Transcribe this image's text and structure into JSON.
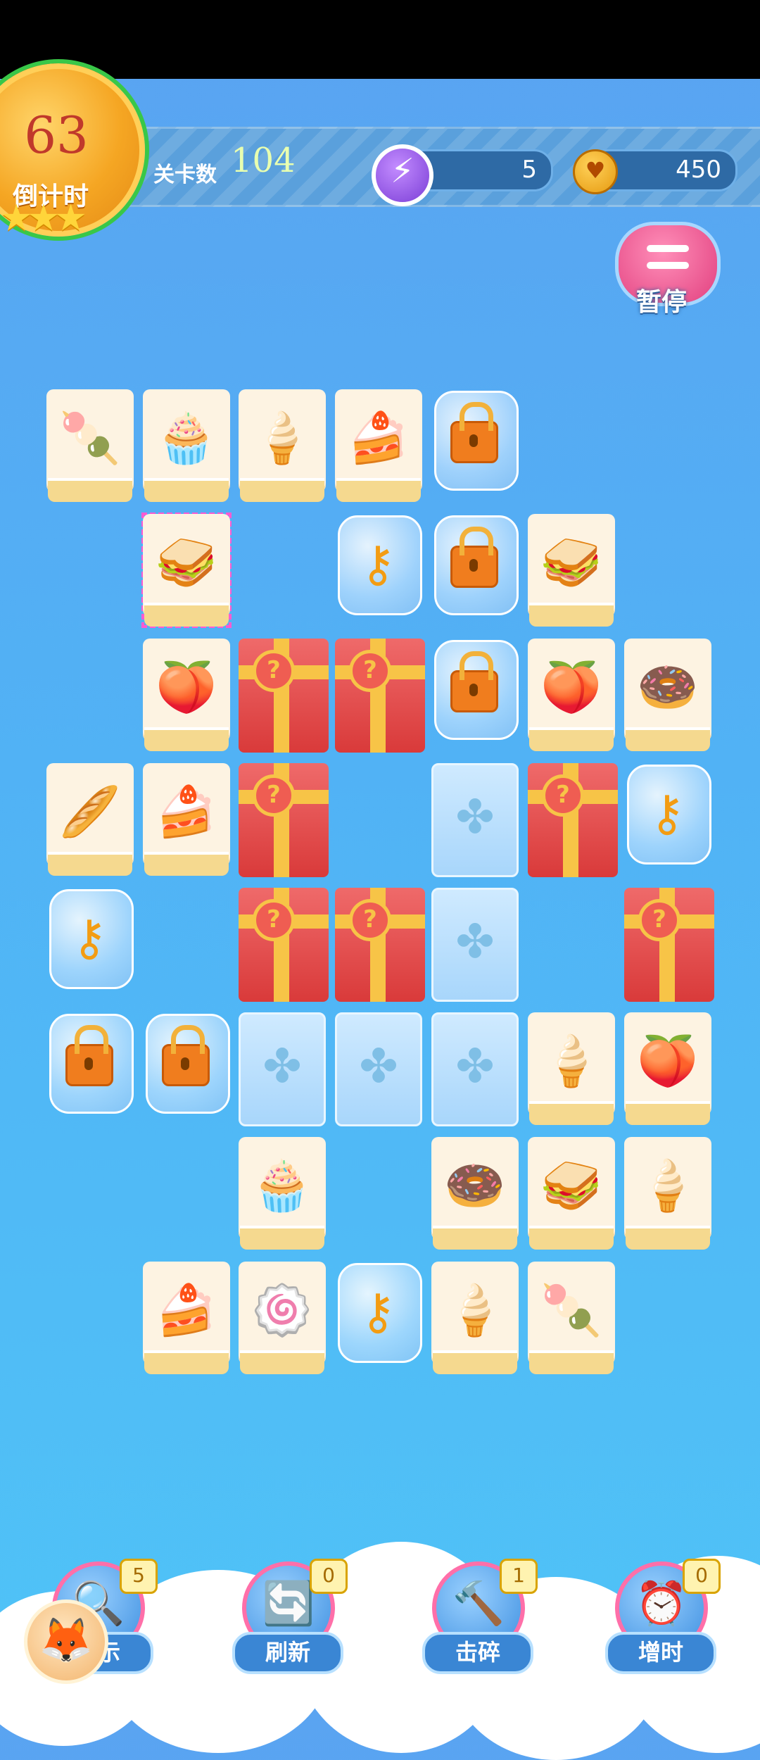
{
  "hud": {
    "timer_value": "63",
    "timer_label": "倒计时",
    "level_label": "关卡数",
    "level_value": "104",
    "energy_value": "5",
    "coins_value": "450",
    "pause_label": "暂停"
  },
  "icons": {
    "energy": "lightning-icon",
    "coins": "heart-coin-icon",
    "pause": "menu-icon"
  },
  "colors": {
    "accent_pink": "#e2407f",
    "tile_cream": "#fdf3e2",
    "gift_red": "#d93a3a",
    "ribbon_gold": "#f7c447"
  },
  "board": {
    "tiles": [
      {
        "type": "food",
        "item": "skewer",
        "glyph": "🍡"
      },
      {
        "type": "food",
        "item": "cupcake",
        "glyph": "🧁"
      },
      {
        "type": "food",
        "item": "ice-cream-cone",
        "glyph": "🍦"
      },
      {
        "type": "food",
        "item": "layer-cake",
        "glyph": "🍰"
      },
      {
        "type": "bubble",
        "item": "lock"
      },
      {
        "type": "food",
        "item": "sandwich",
        "glyph": "🥪",
        "selected": true
      },
      {
        "type": "bubble",
        "item": "key"
      },
      {
        "type": "bubble",
        "item": "lock"
      },
      {
        "type": "food",
        "item": "sandwich",
        "glyph": "🥪"
      },
      {
        "type": "food",
        "item": "peach-bun",
        "glyph": "🍑"
      },
      {
        "type": "gift",
        "item": "mystery-gift"
      },
      {
        "type": "gift",
        "item": "mystery-gift"
      },
      {
        "type": "bubble",
        "item": "lock"
      },
      {
        "type": "food",
        "item": "peach-bun",
        "glyph": "🍑"
      },
      {
        "type": "food",
        "item": "donut",
        "glyph": "🍩"
      },
      {
        "type": "food",
        "item": "bread",
        "glyph": "🥖"
      },
      {
        "type": "food",
        "item": "layer-cake",
        "glyph": "🍰"
      },
      {
        "type": "gift",
        "item": "mystery-gift"
      },
      {
        "type": "ice",
        "item": "ice-block"
      },
      {
        "type": "gift",
        "item": "mystery-gift"
      },
      {
        "type": "bubble",
        "item": "key"
      },
      {
        "type": "bubble",
        "item": "key"
      },
      {
        "type": "gift",
        "item": "mystery-gift"
      },
      {
        "type": "gift",
        "item": "mystery-gift"
      },
      {
        "type": "ice",
        "item": "ice-block"
      },
      {
        "type": "gift",
        "item": "mystery-gift"
      },
      {
        "type": "bubble",
        "item": "lock"
      },
      {
        "type": "bubble",
        "item": "lock"
      },
      {
        "type": "ice",
        "item": "ice-block"
      },
      {
        "type": "ice",
        "item": "ice-block"
      },
      {
        "type": "ice",
        "item": "ice-block"
      },
      {
        "type": "food",
        "item": "ice-cream-cone",
        "glyph": "🍦"
      },
      {
        "type": "food",
        "item": "peach-bun",
        "glyph": "🍑"
      },
      {
        "type": "food",
        "item": "cupcake",
        "glyph": "🧁"
      },
      {
        "type": "food",
        "item": "donut",
        "glyph": "🍩"
      },
      {
        "type": "food",
        "item": "sandwich",
        "glyph": "🥪"
      },
      {
        "type": "food",
        "item": "ice-cream-cone",
        "glyph": "🍦"
      },
      {
        "type": "food",
        "item": "cake-slice",
        "glyph": "🍰"
      },
      {
        "type": "food",
        "item": "swiss-roll",
        "glyph": "🍥"
      },
      {
        "type": "bubble",
        "item": "key"
      },
      {
        "type": "food",
        "item": "ice-cream-cone",
        "glyph": "🍦"
      },
      {
        "type": "food",
        "item": "skewer",
        "glyph": "🍡"
      }
    ]
  },
  "tools": [
    {
      "name": "hint",
      "label": "提示",
      "count": "5",
      "icon": "magnifier-icon",
      "glyph": "🔍"
    },
    {
      "name": "refresh",
      "label": "刷新",
      "count": "0",
      "icon": "refresh-icon",
      "glyph": "🔄"
    },
    {
      "name": "smash",
      "label": "击碎",
      "count": "1",
      "icon": "hammer-icon",
      "glyph": "🔨"
    },
    {
      "name": "add-time",
      "label": "增时",
      "count": "0",
      "icon": "clock-icon",
      "glyph": "⏰"
    }
  ]
}
